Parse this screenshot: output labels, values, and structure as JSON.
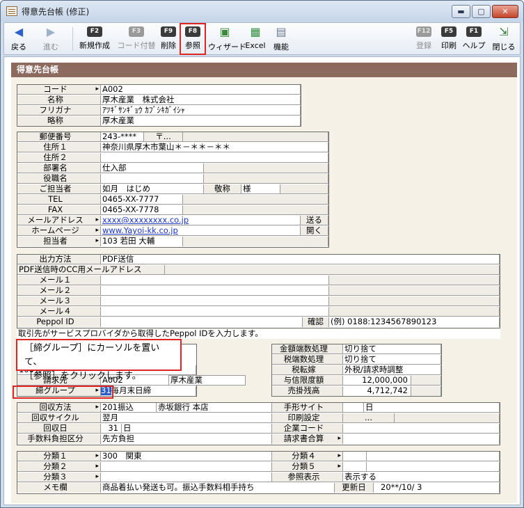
{
  "window": {
    "title": "得意先台帳 (修正)",
    "min": "▬",
    "max": "▢",
    "close": "✕"
  },
  "toolbar": {
    "back": "戻る",
    "forward": "進む",
    "new": {
      "key": "F2",
      "label": "新規作成"
    },
    "code": {
      "key": "F3",
      "label": "コード付替"
    },
    "delete": {
      "key": "F9",
      "label": "削除"
    },
    "ref": {
      "key": "F8",
      "label": "参照"
    },
    "wizard": "ウィザード",
    "excel": "Excel",
    "func": "機能",
    "register": {
      "key": "F12",
      "label": "登録"
    },
    "print": {
      "key": "F5",
      "label": "印刷"
    },
    "help": {
      "key": "F1",
      "label": "ヘルプ"
    },
    "close": "閉じる"
  },
  "header": "得意先台帳",
  "basic": {
    "code_l": "コード",
    "code_v": "A002",
    "name_l": "名称",
    "name_v": "厚木産業　株式会社",
    "kana_l": "フリガナ",
    "kana_v": "ｱﾂｷﾞｻﾝｷﾞｮｳ ｶﾌﾞｼｷｶﾞｲｼｬ",
    "short_l": "略称",
    "short_v": "厚木産業"
  },
  "addr": {
    "zip_l": "郵便番号",
    "zip_v": "243-****",
    "zip_btn": "〒...",
    "addr1_l": "住所１",
    "addr1_v": "神奈川県厚木市葉山＊－＊＊－＊＊",
    "addr2_l": "住所２",
    "dept_l": "部署名",
    "dept_v": "仕入部",
    "title_l": "役職名",
    "person_l": "ご担当者",
    "person_v": "如月　はじめ",
    "hon_l": "敬称",
    "hon_v": "様",
    "tel_l": "TEL",
    "tel_v": "0465-XX-7777",
    "fax_l": "FAX",
    "fax_v": "0465-XX-7778",
    "mail_l": "メールアドレス",
    "mail_v": "xxxx@xxxxxxxx.co.jp",
    "send": "送る",
    "hp_l": "ホームページ",
    "hp_v": "www.Yayoi-kk.co.jp",
    "open": "開く",
    "staff_l": "担当者",
    "staff_v": "103 若田 大輔"
  },
  "output": {
    "method_l": "出力方法",
    "method_v": "PDF送信",
    "cc_l": "PDF送信時のCC用メールアドレス",
    "m1": "メール１",
    "m2": "メール２",
    "m3": "メール３",
    "m4": "メール４",
    "peppol_l": "Peppol ID",
    "confirm": "確認",
    "example": "(例) 0188:1234567890123",
    "note": "取引先がサービスプロバイダから取得したPeppol IDを入力します。"
  },
  "billing": {
    "rate_v": "100%",
    "billto_l": "請求先",
    "billto_code": "A002",
    "billto_name": "厚木産業",
    "close_l": "締グループ",
    "close_v": "31",
    "close_name": "毎月末日締",
    "round_l": "金額端数処理",
    "round_v": "切り捨て",
    "tax_round_l": "税端数処理",
    "tax_round_v": "切り捨て",
    "tax_mode_l": "税転嫁",
    "tax_mode_v": "外税/請求時調整",
    "limit_l": "与信限度額",
    "limit_v": "12,000,000",
    "balance_l": "売掛残高",
    "balance_v": "4,712,742"
  },
  "collect": {
    "method_l": "回収方法",
    "method_v": "201振込",
    "bank_v": "赤坂銀行 本店",
    "cycle_l": "回収サイクル",
    "cycle_v": "翌月",
    "day_l": "回収日",
    "day_v": "31",
    "day_unit": "日",
    "fee_l": "手数料負担区分",
    "fee_v": "先方負担",
    "bill_site_l": "手形サイト",
    "bill_site_unit": "日",
    "print_l": "印刷設定",
    "print_btn": "...",
    "corp_l": "企業コード",
    "invoice_l": "請求書合算"
  },
  "class": {
    "c1_l": "分類１",
    "c1_v": "300　関東",
    "c2_l": "分類２",
    "c3_l": "分類３",
    "c4_l": "分類４",
    "c5_l": "分類５",
    "ref_l": "参照表示",
    "ref_v": "表示する",
    "memo_l": "メモ欄",
    "memo_v": "商品着払い発送も可。振込手数料相手持ち",
    "upd_l": "更新日",
    "upd_v": "20**/10/ 3"
  },
  "callout": {
    "line1": "［締グループ］にカーソルを置いて、",
    "line2": "［参照］をクリックします。"
  }
}
